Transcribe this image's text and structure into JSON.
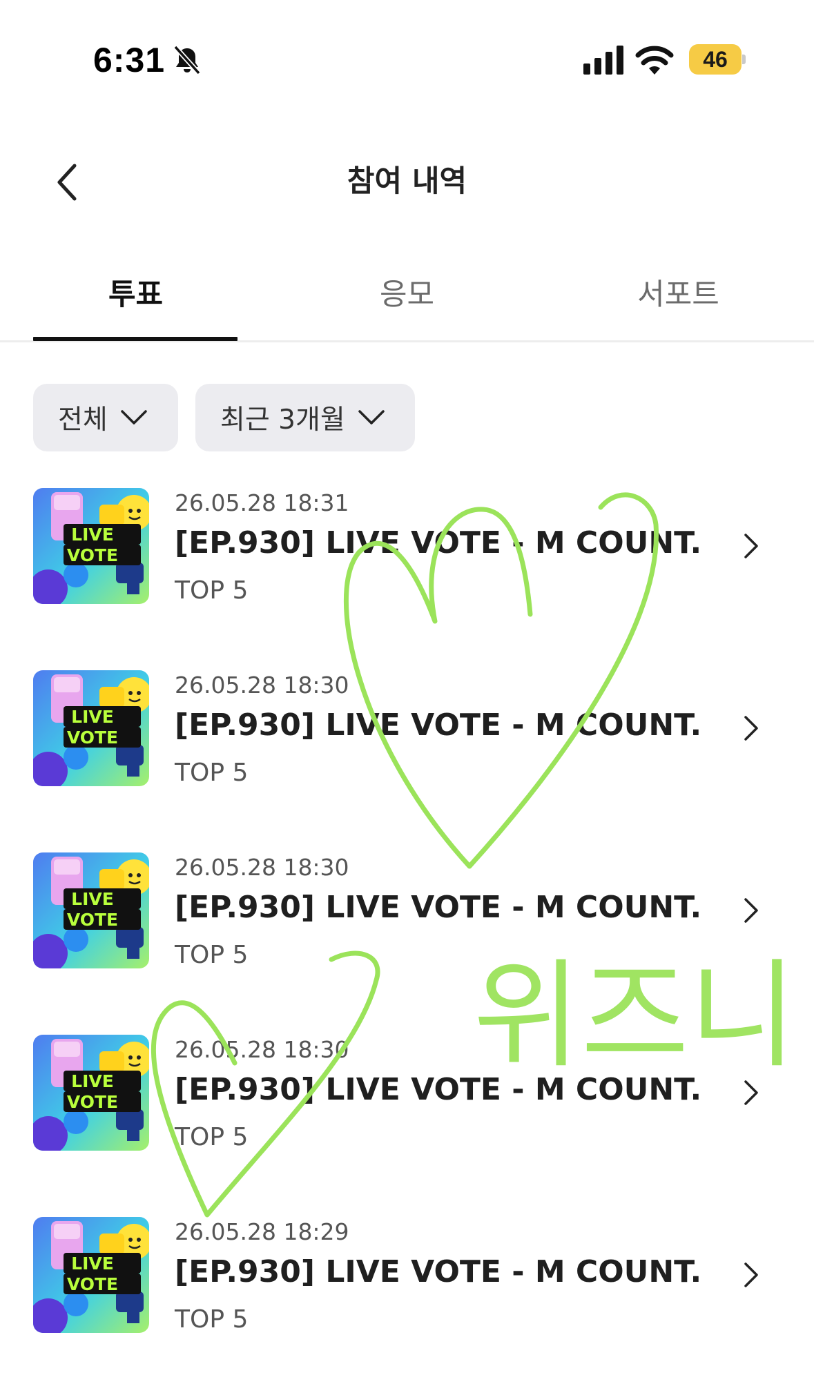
{
  "status_bar": {
    "time": "6:31",
    "battery": "46",
    "icons": [
      "bell-slash-icon",
      "cellular-signal-icon",
      "wifi-icon",
      "battery-icon"
    ]
  },
  "header": {
    "title": "참여 내역",
    "back_icon": "chevron-left-icon"
  },
  "tabs": [
    {
      "label": "투표",
      "active": true
    },
    {
      "label": "응모",
      "active": false
    },
    {
      "label": "서포트",
      "active": false
    }
  ],
  "filters": {
    "type": "전체",
    "period": "최근 3개월"
  },
  "votes": [
    {
      "date": "26.05.28 18:31",
      "title": "[EP.930] LIVE VOTE - M COUNT...",
      "detail": "TOP 5"
    },
    {
      "date": "26.05.28 18:30",
      "title": "[EP.930] LIVE VOTE - M COUNT...",
      "detail": "TOP 5"
    },
    {
      "date": "26.05.28 18:30",
      "title": "[EP.930] LIVE VOTE - M COUNT...",
      "detail": "TOP 5"
    },
    {
      "date": "26.05.28 18:30",
      "title": "[EP.930] LIVE VOTE - M COUNT...",
      "detail": "TOP 5"
    },
    {
      "date": "26.05.28 18:29",
      "title": "[EP.930] LIVE VOTE - M COUNT...",
      "detail": "TOP 5"
    }
  ],
  "thumbnail": {
    "line1": "LIVE",
    "line2": "VOTE"
  },
  "annotation": {
    "handwriting": "위즈니",
    "color": "#9be35a"
  },
  "colors": {
    "accent": "#111111",
    "filter_bg": "#ececf0",
    "battery": "#f6cb45"
  }
}
